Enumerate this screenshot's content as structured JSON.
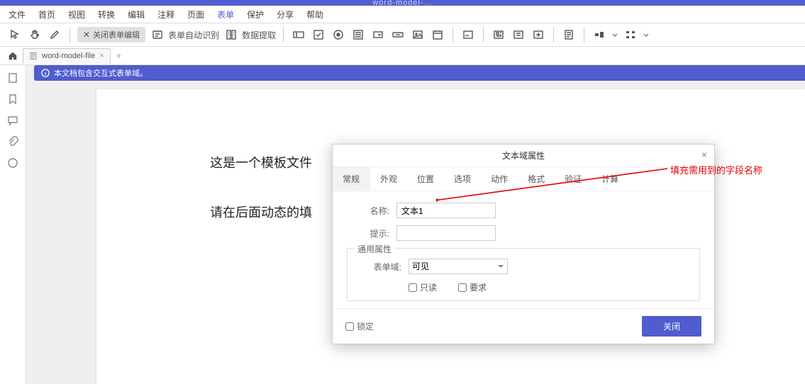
{
  "app_title": "word-model-...",
  "menu": {
    "items": [
      "文件",
      "首页",
      "视图",
      "转换",
      "编辑",
      "注释",
      "页面",
      "表单",
      "保护",
      "分享",
      "帮助"
    ],
    "active_index": 7
  },
  "toolbar": {
    "close_form_edit": "关闭表单编辑",
    "auto_recognize": "表单自动识别",
    "data_extract": "数据提取"
  },
  "tab": {
    "filename": "word-model-file"
  },
  "banner": {
    "text": "本文档包含交互式表单域。"
  },
  "doc": {
    "line1": "这是一个模板文件",
    "line2": "请在后面动态的填"
  },
  "dialog": {
    "title": "文本域属性",
    "tabs": [
      "常规",
      "外观",
      "位置",
      "选项",
      "动作",
      "格式",
      "验证",
      "计算"
    ],
    "name_label": "名称:",
    "name_value": "文本1",
    "tip_label": "提示:",
    "tip_value": "",
    "fieldset_legend": "通用属性",
    "field_label": "表单域:",
    "field_value": "可见",
    "readonly_label": "只读",
    "required_label": "要求",
    "lock_label": "锁定",
    "close_btn": "关闭"
  },
  "annotation": "填充需用到的字段名称"
}
